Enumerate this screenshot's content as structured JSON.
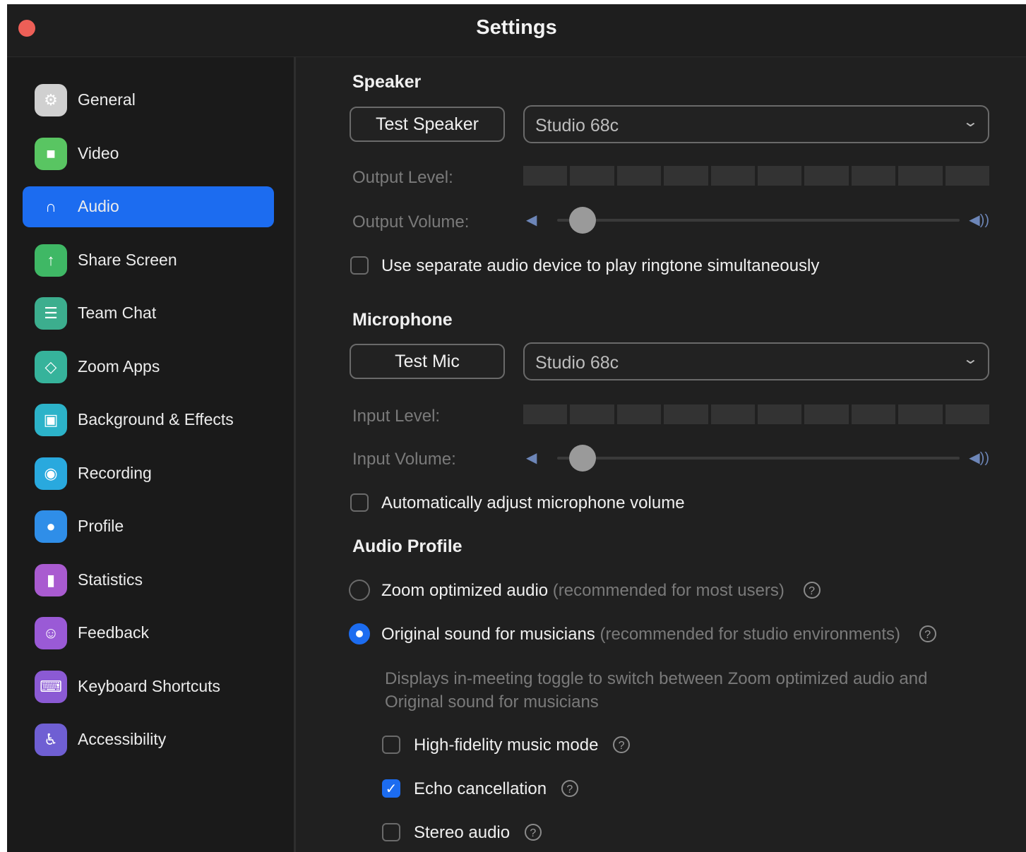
{
  "window": {
    "title": "Settings"
  },
  "sidebar": {
    "items": [
      {
        "label": "General",
        "icon": "gear-icon",
        "color": "#d0d0d0",
        "glyph": "⚙"
      },
      {
        "label": "Video",
        "icon": "video-camera-icon",
        "color": "#59c562",
        "glyph": "■"
      },
      {
        "label": "Audio",
        "icon": "headphones-icon",
        "color": "#1c6cf0",
        "glyph": "∩",
        "active": true
      },
      {
        "label": "Share Screen",
        "icon": "share-screen-icon",
        "color": "#3fb865",
        "glyph": "↑"
      },
      {
        "label": "Team Chat",
        "icon": "chat-icon",
        "color": "#3cae8e",
        "glyph": "☰"
      },
      {
        "label": "Zoom Apps",
        "icon": "apps-icon",
        "color": "#36b39b",
        "glyph": "◇"
      },
      {
        "label": "Background & Effects",
        "icon": "background-icon",
        "color": "#2cb3c9",
        "glyph": "▣"
      },
      {
        "label": "Recording",
        "icon": "recording-icon",
        "color": "#29a9de",
        "glyph": "◉"
      },
      {
        "label": "Profile",
        "icon": "profile-icon",
        "color": "#2f8ee8",
        "glyph": "●"
      },
      {
        "label": "Statistics",
        "icon": "statistics-icon",
        "color": "#a95bd0",
        "glyph": "▮"
      },
      {
        "label": "Feedback",
        "icon": "feedback-icon",
        "color": "#9a5ad6",
        "glyph": "☺"
      },
      {
        "label": "Keyboard Shortcuts",
        "icon": "keyboard-icon",
        "color": "#8b5ad4",
        "glyph": "⌨"
      },
      {
        "label": "Accessibility",
        "icon": "accessibility-icon",
        "color": "#6f5fd3",
        "glyph": "♿"
      }
    ]
  },
  "speaker": {
    "heading": "Speaker",
    "test_label": "Test Speaker",
    "device": "Studio 68c",
    "output_level_label": "Output Level:",
    "output_volume_label": "Output Volume:",
    "output_volume_level": 0.05,
    "separate_device_label": "Use separate audio device to play ringtone simultaneously"
  },
  "microphone": {
    "heading": "Microphone",
    "test_label": "Test Mic",
    "device": "Studio 68c",
    "input_level_label": "Input Level:",
    "input_volume_label": "Input Volume:",
    "input_volume_level": 0.05,
    "auto_adjust_label": "Automatically adjust microphone volume"
  },
  "audio_profile": {
    "heading": "Audio Profile",
    "option1_label": "Zoom optimized audio",
    "option1_note": "(recommended for most users)",
    "option2_label": "Original sound for musicians",
    "option2_note": "(recommended for studio environments)",
    "description": "Displays in-meeting toggle to switch between Zoom optimized audio and Original sound for musicians",
    "high_fidelity_label": "High-fidelity music mode",
    "echo_cancellation_label": "Echo cancellation",
    "stereo_label": "Stereo audio",
    "help_glyph": "?",
    "check_glyph": "✓"
  },
  "glyphs": {
    "chevron": "⌄",
    "vol_low": "◀",
    "vol_high": "◀))"
  },
  "accent_color": "#1c6cf0"
}
